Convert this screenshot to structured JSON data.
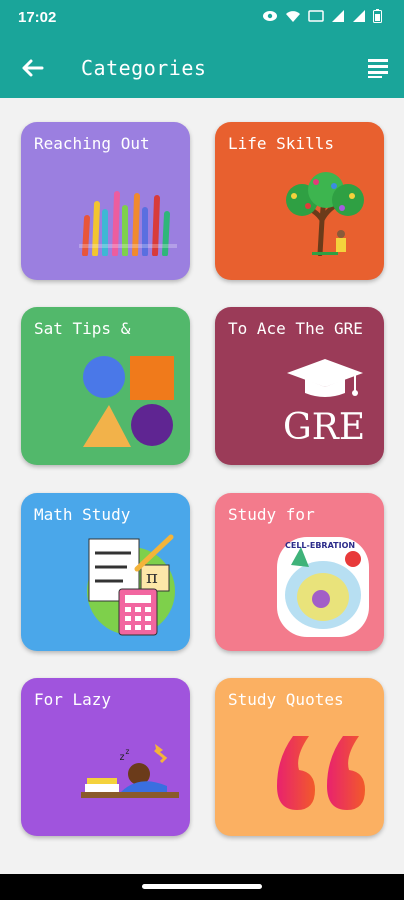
{
  "status": {
    "time": "17:02"
  },
  "header": {
    "title": "Categories",
    "back_icon": "arrow-left-icon",
    "menu_icon": "list-menu-icon"
  },
  "colors": {
    "appbar": "#1aa59a",
    "background": "#f2f2f2"
  },
  "categories": [
    {
      "label": "Reaching Out",
      "color": "#9b7fe0",
      "icon": "raised-hands-icon"
    },
    {
      "label": "Life Skills",
      "color": "#e8602f",
      "icon": "tree-icon"
    },
    {
      "label": "Sat Tips &",
      "color": "#52b86b",
      "icon": "shapes-icon"
    },
    {
      "label": "To Ace The GRE",
      "color": "#9b3b58",
      "icon": "graduation-cap-icon",
      "art_text": "GRE"
    },
    {
      "label": "Math Study",
      "color": "#4aa7ea",
      "icon": "math-tools-icon",
      "art_text": "π"
    },
    {
      "label": "Study for",
      "color": "#f37b8c",
      "icon": "cell-sticker-icon",
      "art_text": "CELL-EBRATION"
    },
    {
      "label": "For Lazy",
      "color": "#a054dd",
      "icon": "sleeping-student-icon"
    },
    {
      "label": "Study Quotes",
      "color": "#fbb062",
      "icon": "quote-marks-icon"
    }
  ]
}
